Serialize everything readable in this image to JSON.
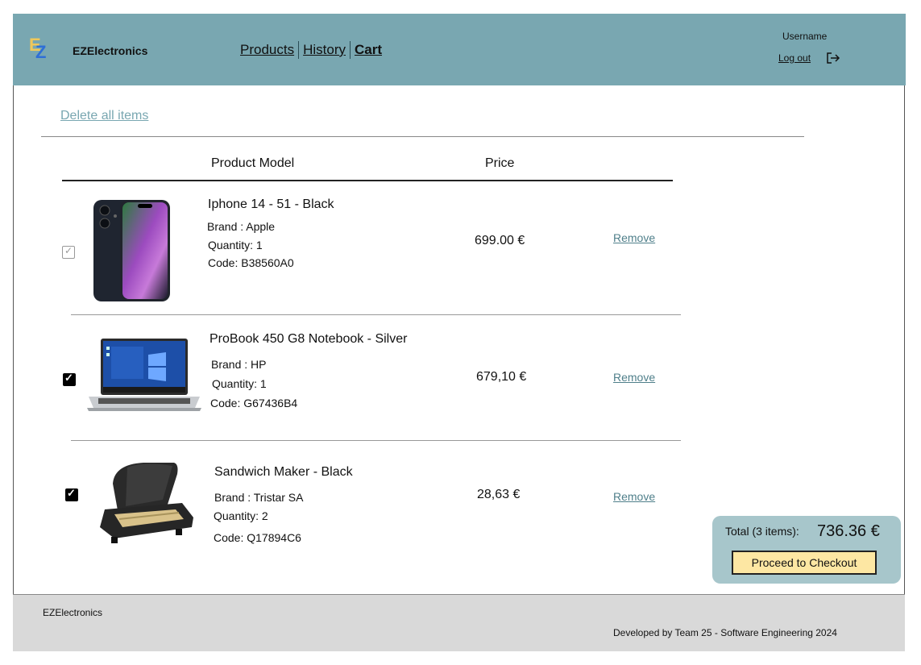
{
  "header": {
    "brand": "EZElectronics",
    "logo_letters": {
      "top": "E",
      "bottom": "Z"
    },
    "nav": [
      {
        "label": "Products"
      },
      {
        "label": "History"
      },
      {
        "label": "Cart"
      }
    ],
    "user": {
      "name": "Username",
      "logout_label": "Log out",
      "logout_icon": "logout-arrow-icon"
    }
  },
  "cart": {
    "delete_all_label": "Delete all items",
    "columns": {
      "model": "Product Model",
      "price": "Price"
    },
    "items": [
      {
        "checked": false,
        "name": "Iphone 14 - 51 - Black",
        "brand": "Brand : Apple",
        "quantity": "Quantity: 1",
        "code": "Code: B38560A0",
        "price": "699.00 €",
        "remove_label": "Remove",
        "image": "iphone-image"
      },
      {
        "checked": true,
        "name": "ProBook 450 G8 Notebook - Silver",
        "brand": "Brand : HP",
        "quantity": "Quantity: 1",
        "code": "Code: G67436B4",
        "price": "679,10  €",
        "remove_label": "Remove",
        "image": "laptop-image"
      },
      {
        "checked": true,
        "name": "Sandwich Maker  - Black",
        "brand": "Brand : Tristar SA",
        "quantity": "Quantity: 2",
        "code": "Code: Q17894C6",
        "price": "28,63 €",
        "remove_label": "Remove",
        "image": "sandwich-maker-image"
      }
    ],
    "summary": {
      "total_label": "Total (3 items):",
      "total_value": "736.36 €",
      "checkout_label": "Proceed to Checkout"
    }
  },
  "footer": {
    "brand": "EZElectronics",
    "credit": "Developed by Team 25 - Software Engineering 2024"
  },
  "colors": {
    "header_bg": "#79a7b1",
    "accent_link": "#79a7b1",
    "checkout_bg": "#fde7a3",
    "summary_bg": "#a7c6cb",
    "footer_bg": "#d9d9d9"
  }
}
